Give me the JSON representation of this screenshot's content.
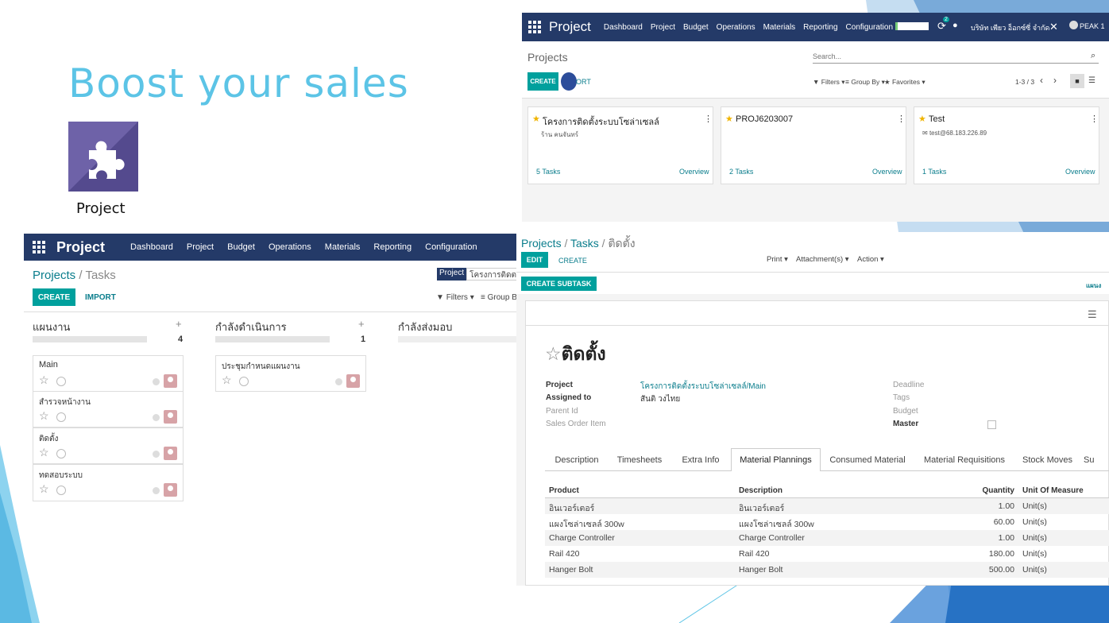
{
  "slide": {
    "title": "Boost your sales",
    "app_label": "Project",
    "accent_color": "#5cc4e6"
  },
  "top_window": {
    "app_name": "Project",
    "menu": [
      "Dashboard",
      "Project",
      "Budget",
      "Operations",
      "Materials",
      "Reporting",
      "Configuration"
    ],
    "notification_count": "2",
    "company": "บริษัท เพียว อ็อกซ์ซี่ จำกัด",
    "user": "PEAK 1",
    "breadcrumb": "Projects",
    "search_placeholder": "Search...",
    "create_label": "CREATE",
    "import_label": "ORT",
    "filters_label": "Filters",
    "group_by_label": "Group By",
    "favorites_label": "Favorites",
    "pager": "1-3 / 3",
    "cards": [
      {
        "title": "โครงการติดตั้งระบบโซล่าเซลล์",
        "subtitle": "ร้าน คนจันทร์",
        "tasks": "5 Tasks",
        "overview": "Overview"
      },
      {
        "title": "PROJ6203007",
        "subtitle": "",
        "tasks": "2 Tasks",
        "overview": "Overview"
      },
      {
        "title": "Test",
        "subtitle": "test@68.183.226.89",
        "tasks": "1 Tasks",
        "overview": "Overview"
      }
    ]
  },
  "kanban_window": {
    "app_name": "Project",
    "menu": [
      "Dashboard",
      "Project",
      "Budget",
      "Operations",
      "Materials",
      "Reporting",
      "Configuration"
    ],
    "breadcrumb_root": "Projects",
    "breadcrumb_current": "Tasks",
    "search_facet_label": "Project",
    "search_facet_value": "โครงการติดต",
    "create_label": "CREATE",
    "import_label": "IMPORT",
    "filters_label": "Filters",
    "group_by_label": "Group B",
    "columns": [
      {
        "name": "แผนงาน",
        "count": "4",
        "progress": 1.0,
        "cards": [
          "Main",
          "สำรวจหน้างาน",
          "ติดตั้ง",
          "ทดสอบระบบ"
        ]
      },
      {
        "name": "กำลังดำเนินการ",
        "count": "1",
        "progress": 1.0,
        "cards": [
          "ประชุมกำหนดแผนงาน"
        ]
      },
      {
        "name": "กำลังส่งมอบ",
        "count": "",
        "progress": 0.0,
        "cards": []
      }
    ]
  },
  "form_window": {
    "breadcrumb_1": "Projects",
    "breadcrumb_2": "Tasks",
    "breadcrumb_3": "ติดตั้ง",
    "edit_label": "EDIT",
    "create_label": "CREATE",
    "print_label": "Print",
    "attachment_label": "Attachment(s)",
    "action_label": "Action",
    "subtask_label": "CREATE SUBTASK",
    "stage_label": "แผนง",
    "task_title": "ติดตั้ง",
    "fields_left": [
      {
        "label": "Project",
        "value": "โครงการติดตั้งระบบโซล่าเซลล์/Main"
      },
      {
        "label": "Assigned to",
        "value": "สันติ วงไทย"
      },
      {
        "label": "Parent Id",
        "value": ""
      },
      {
        "label": "Sales Order Item",
        "value": ""
      }
    ],
    "fields_right": [
      {
        "label": "Deadline"
      },
      {
        "label": "Tags"
      },
      {
        "label": "Budget"
      },
      {
        "label": "Master"
      }
    ],
    "tabs": [
      "Description",
      "Timesheets",
      "Extra Info",
      "Material Plannings",
      "Consumed Material",
      "Material Requisitions",
      "Stock Moves",
      "Su"
    ],
    "active_tab": "Material Plannings",
    "table_headers": [
      "Product",
      "Description",
      "Quantity",
      "Unit Of Measure"
    ],
    "rows": [
      {
        "product": "อินเวอร์เตอร์",
        "description": "อินเวอร์เตอร์",
        "quantity": "1.00",
        "uom": "Unit(s)"
      },
      {
        "product": "แผงโซล่าเซลล์ 300w",
        "description": "แผงโซล่าเซลล์ 300w",
        "quantity": "60.00",
        "uom": "Unit(s)"
      },
      {
        "product": "Charge Controller",
        "description": "Charge Controller",
        "quantity": "1.00",
        "uom": "Unit(s)"
      },
      {
        "product": "Rail 420",
        "description": "Rail 420",
        "quantity": "180.00",
        "uom": "Unit(s)"
      },
      {
        "product": "Hanger Bolt",
        "description": "Hanger Bolt",
        "quantity": "500.00",
        "uom": "Unit(s)"
      }
    ]
  }
}
